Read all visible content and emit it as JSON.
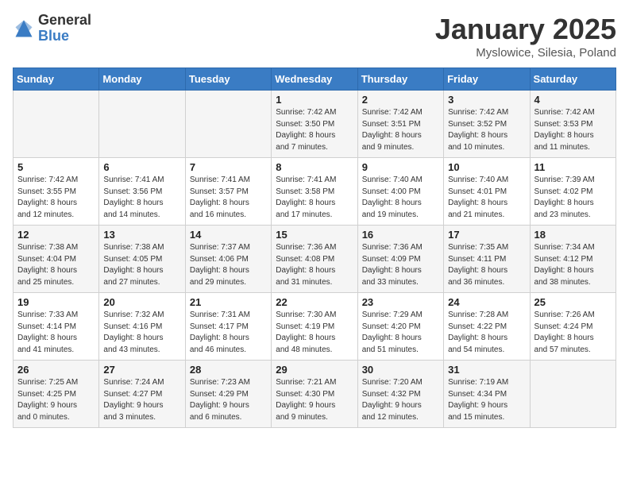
{
  "logo": {
    "general": "General",
    "blue": "Blue"
  },
  "title": "January 2025",
  "location": "Myslowice, Silesia, Poland",
  "weekdays": [
    "Sunday",
    "Monday",
    "Tuesday",
    "Wednesday",
    "Thursday",
    "Friday",
    "Saturday"
  ],
  "weeks": [
    [
      {
        "day": "",
        "info": ""
      },
      {
        "day": "",
        "info": ""
      },
      {
        "day": "",
        "info": ""
      },
      {
        "day": "1",
        "info": "Sunrise: 7:42 AM\nSunset: 3:50 PM\nDaylight: 8 hours\nand 7 minutes."
      },
      {
        "day": "2",
        "info": "Sunrise: 7:42 AM\nSunset: 3:51 PM\nDaylight: 8 hours\nand 9 minutes."
      },
      {
        "day": "3",
        "info": "Sunrise: 7:42 AM\nSunset: 3:52 PM\nDaylight: 8 hours\nand 10 minutes."
      },
      {
        "day": "4",
        "info": "Sunrise: 7:42 AM\nSunset: 3:53 PM\nDaylight: 8 hours\nand 11 minutes."
      }
    ],
    [
      {
        "day": "5",
        "info": "Sunrise: 7:42 AM\nSunset: 3:55 PM\nDaylight: 8 hours\nand 12 minutes."
      },
      {
        "day": "6",
        "info": "Sunrise: 7:41 AM\nSunset: 3:56 PM\nDaylight: 8 hours\nand 14 minutes."
      },
      {
        "day": "7",
        "info": "Sunrise: 7:41 AM\nSunset: 3:57 PM\nDaylight: 8 hours\nand 16 minutes."
      },
      {
        "day": "8",
        "info": "Sunrise: 7:41 AM\nSunset: 3:58 PM\nDaylight: 8 hours\nand 17 minutes."
      },
      {
        "day": "9",
        "info": "Sunrise: 7:40 AM\nSunset: 4:00 PM\nDaylight: 8 hours\nand 19 minutes."
      },
      {
        "day": "10",
        "info": "Sunrise: 7:40 AM\nSunset: 4:01 PM\nDaylight: 8 hours\nand 21 minutes."
      },
      {
        "day": "11",
        "info": "Sunrise: 7:39 AM\nSunset: 4:02 PM\nDaylight: 8 hours\nand 23 minutes."
      }
    ],
    [
      {
        "day": "12",
        "info": "Sunrise: 7:38 AM\nSunset: 4:04 PM\nDaylight: 8 hours\nand 25 minutes."
      },
      {
        "day": "13",
        "info": "Sunrise: 7:38 AM\nSunset: 4:05 PM\nDaylight: 8 hours\nand 27 minutes."
      },
      {
        "day": "14",
        "info": "Sunrise: 7:37 AM\nSunset: 4:06 PM\nDaylight: 8 hours\nand 29 minutes."
      },
      {
        "day": "15",
        "info": "Sunrise: 7:36 AM\nSunset: 4:08 PM\nDaylight: 8 hours\nand 31 minutes."
      },
      {
        "day": "16",
        "info": "Sunrise: 7:36 AM\nSunset: 4:09 PM\nDaylight: 8 hours\nand 33 minutes."
      },
      {
        "day": "17",
        "info": "Sunrise: 7:35 AM\nSunset: 4:11 PM\nDaylight: 8 hours\nand 36 minutes."
      },
      {
        "day": "18",
        "info": "Sunrise: 7:34 AM\nSunset: 4:12 PM\nDaylight: 8 hours\nand 38 minutes."
      }
    ],
    [
      {
        "day": "19",
        "info": "Sunrise: 7:33 AM\nSunset: 4:14 PM\nDaylight: 8 hours\nand 41 minutes."
      },
      {
        "day": "20",
        "info": "Sunrise: 7:32 AM\nSunset: 4:16 PM\nDaylight: 8 hours\nand 43 minutes."
      },
      {
        "day": "21",
        "info": "Sunrise: 7:31 AM\nSunset: 4:17 PM\nDaylight: 8 hours\nand 46 minutes."
      },
      {
        "day": "22",
        "info": "Sunrise: 7:30 AM\nSunset: 4:19 PM\nDaylight: 8 hours\nand 48 minutes."
      },
      {
        "day": "23",
        "info": "Sunrise: 7:29 AM\nSunset: 4:20 PM\nDaylight: 8 hours\nand 51 minutes."
      },
      {
        "day": "24",
        "info": "Sunrise: 7:28 AM\nSunset: 4:22 PM\nDaylight: 8 hours\nand 54 minutes."
      },
      {
        "day": "25",
        "info": "Sunrise: 7:26 AM\nSunset: 4:24 PM\nDaylight: 8 hours\nand 57 minutes."
      }
    ],
    [
      {
        "day": "26",
        "info": "Sunrise: 7:25 AM\nSunset: 4:25 PM\nDaylight: 9 hours\nand 0 minutes."
      },
      {
        "day": "27",
        "info": "Sunrise: 7:24 AM\nSunset: 4:27 PM\nDaylight: 9 hours\nand 3 minutes."
      },
      {
        "day": "28",
        "info": "Sunrise: 7:23 AM\nSunset: 4:29 PM\nDaylight: 9 hours\nand 6 minutes."
      },
      {
        "day": "29",
        "info": "Sunrise: 7:21 AM\nSunset: 4:30 PM\nDaylight: 9 hours\nand 9 minutes."
      },
      {
        "day": "30",
        "info": "Sunrise: 7:20 AM\nSunset: 4:32 PM\nDaylight: 9 hours\nand 12 minutes."
      },
      {
        "day": "31",
        "info": "Sunrise: 7:19 AM\nSunset: 4:34 PM\nDaylight: 9 hours\nand 15 minutes."
      },
      {
        "day": "",
        "info": ""
      }
    ]
  ]
}
